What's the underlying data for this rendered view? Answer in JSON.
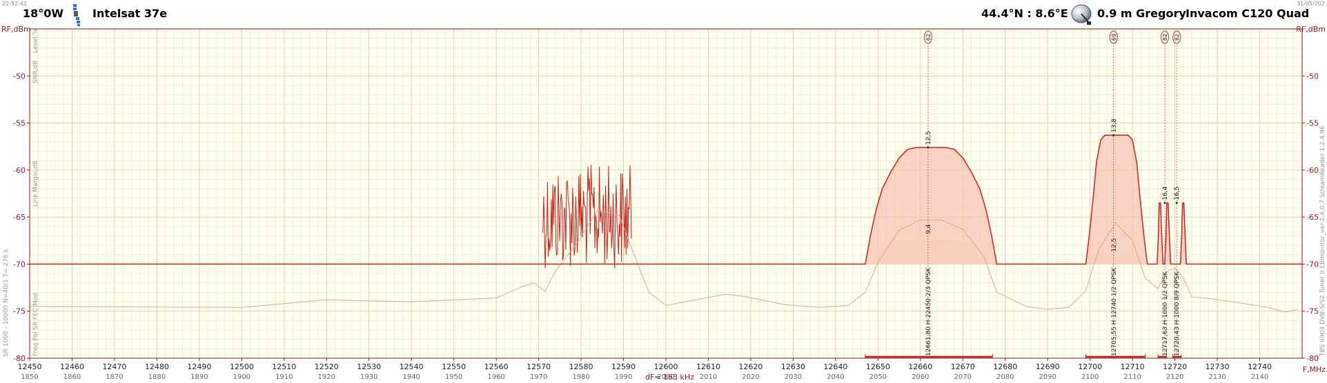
{
  "header": {
    "time": "22:52:42",
    "date": "31/05/202",
    "orbital_position": "18°0W",
    "satellite_name": "Intelsat 37e",
    "location": "44.4°N : 8.6°E",
    "dish_info": "0.9 m Gregory",
    "lnb_info": "Invacom C120 Quad",
    "satellite_icon": "satellite-icon",
    "dish_icon": "dish-icon"
  },
  "colors": {
    "background": "#fffff0",
    "grid": "#e2dcc0",
    "axis": "#8b1a1a",
    "trace": "#c8201a",
    "fill": "#f7c4b4",
    "avg": "#e8a090"
  },
  "side_labels": {
    "left_top": [
      "Level,%",
      "SNR,dB",
      "Link Margin,dB"
    ],
    "left_bottom": "Freq  Pol  SR  FEC  Mod",
    "left_params": "SR 1000 - 10000  N=40/1  T= 276 s",
    "right": "TBS 6903 DVB-S/S2 Tuner 0   EBmonitor_ver.2.4.0.7   StreamReader 1.2.4.96"
  },
  "chart_data": {
    "type": "line",
    "ylabel_left": "RF,dBm",
    "ylabel_right": "RF,dBm",
    "xlabel": "F,MHz",
    "xlim": [
      12450,
      12750
    ],
    "ylim": [
      -80,
      -45
    ],
    "yticks": [
      -50,
      -55,
      -60,
      -65,
      -70,
      -75,
      -80
    ],
    "xticks": [
      12450,
      12460,
      12470,
      12480,
      12490,
      12500,
      12510,
      12520,
      12530,
      12540,
      12550,
      12560,
      12570,
      12580,
      12590,
      12600,
      12610,
      12620,
      12630,
      12640,
      12650,
      12660,
      12670,
      12680,
      12690,
      12700,
      12710,
      12720,
      12730,
      12740
    ],
    "xticks_if": [
      1850,
      1860,
      1870,
      1880,
      1890,
      1900,
      1910,
      1920,
      1930,
      1940,
      1950,
      1960,
      1970,
      1980,
      1990,
      2000,
      2010,
      2020,
      2030,
      2040,
      2050,
      2060,
      2070,
      2080,
      2090,
      2100,
      2110,
      2120,
      2130,
      2140
    ],
    "df_label": "dF= 163 kHz",
    "grid": true,
    "noise_floor": -70,
    "spectrum": [
      [
        12450,
        -70
      ],
      [
        12570.5,
        -70
      ],
      [
        12591,
        -70
      ],
      [
        12647,
        -70
      ],
      [
        12648.2,
        -67
      ],
      [
        12649.5,
        -64.3
      ],
      [
        12651,
        -62
      ],
      [
        12653,
        -60.2
      ],
      [
        12655,
        -58.7
      ],
      [
        12657,
        -57.8
      ],
      [
        12659,
        -57.6
      ],
      [
        12666,
        -57.6
      ],
      [
        12668,
        -57.8
      ],
      [
        12670,
        -58.7
      ],
      [
        12672,
        -60.2
      ],
      [
        12674,
        -62
      ],
      [
        12675.5,
        -64.3
      ],
      [
        12676.8,
        -67
      ],
      [
        12678,
        -70
      ],
      [
        12699,
        -70
      ],
      [
        12699.8,
        -67
      ],
      [
        12700.6,
        -63.5
      ],
      [
        12701.5,
        -59.2
      ],
      [
        12702.5,
        -56.8
      ],
      [
        12703.5,
        -56.3
      ],
      [
        12709,
        -56.3
      ],
      [
        12710,
        -56.8
      ],
      [
        12711,
        -59.2
      ],
      [
        12711.9,
        -63.5
      ],
      [
        12712.7,
        -67
      ],
      [
        12713.5,
        -70
      ],
      [
        12715.8,
        -70
      ],
      [
        12716.1,
        -67
      ],
      [
        12716.3,
        -63.5
      ],
      [
        12716.6,
        -63.5
      ],
      [
        12716.9,
        -67
      ],
      [
        12717.2,
        -70
      ],
      [
        12717.6,
        -70
      ],
      [
        12717.9,
        -67
      ],
      [
        12718.1,
        -63.5
      ],
      [
        12718.4,
        -63.5
      ],
      [
        12718.7,
        -67
      ],
      [
        12719,
        -70
      ],
      [
        12721.3,
        -70
      ],
      [
        12721.6,
        -67
      ],
      [
        12721.8,
        -63.5
      ],
      [
        12722.1,
        -63.5
      ],
      [
        12722.4,
        -67
      ],
      [
        12722.7,
        -70
      ],
      [
        12750,
        -70
      ]
    ],
    "noise_region": {
      "x_start": 12571,
      "x_end": 12592,
      "peak": -59.4,
      "min": -70.5
    },
    "average": [
      [
        12450,
        -74.5
      ],
      [
        12500,
        -74.6
      ],
      [
        12520,
        -73.8
      ],
      [
        12540,
        -74
      ],
      [
        12560,
        -73.6
      ],
      [
        12566,
        -72.4
      ],
      [
        12569,
        -72
      ],
      [
        12571.5,
        -72.9
      ],
      [
        12574,
        -70.7
      ],
      [
        12579,
        -67.8
      ],
      [
        12584,
        -64.2
      ],
      [
        12589,
        -64.8
      ],
      [
        12592,
        -68.4
      ],
      [
        12596,
        -73
      ],
      [
        12600,
        -74.4
      ],
      [
        12614,
        -73.2
      ],
      [
        12618,
        -73.4
      ],
      [
        12628,
        -74.3
      ],
      [
        12636,
        -74.6
      ],
      [
        12643,
        -74.4
      ],
      [
        12647,
        -73
      ],
      [
        12650,
        -69.8
      ],
      [
        12655,
        -66.4
      ],
      [
        12660,
        -65.3
      ],
      [
        12665,
        -65.3
      ],
      [
        12670,
        -66.3
      ],
      [
        12675,
        -69.2
      ],
      [
        12678,
        -73
      ],
      [
        12685,
        -74.5
      ],
      [
        12690,
        -74.8
      ],
      [
        12695,
        -74.6
      ],
      [
        12699,
        -72.8
      ],
      [
        12702,
        -68.5
      ],
      [
        12706,
        -65.6
      ],
      [
        12710,
        -67.5
      ],
      [
        12713,
        -71.5
      ],
      [
        12716,
        -72.6
      ],
      [
        12718,
        -70.8
      ],
      [
        12720,
        -70.4
      ],
      [
        12722,
        -71.5
      ],
      [
        12724,
        -73.5
      ],
      [
        12727,
        -73.6
      ],
      [
        12735,
        -74.1
      ],
      [
        12742,
        -74.6
      ],
      [
        12746,
        -75.1
      ],
      [
        12749,
        -74.8
      ]
    ],
    "lower_fill": [
      [
        {
          "x": 12648,
          "y": -70
        },
        {
          "x": 12651,
          "y": -68.4
        },
        {
          "x": 12655,
          "y": -67.5
        },
        {
          "x": 12660,
          "y": -67.3
        },
        {
          "x": 12665,
          "y": -67.3
        },
        {
          "x": 12670,
          "y": -67.6
        },
        {
          "x": 12674,
          "y": -68.5
        },
        {
          "x": 12677,
          "y": -70
        }
      ],
      [
        {
          "x": 12700.5,
          "y": -70
        },
        {
          "x": 12701.5,
          "y": -69
        },
        {
          "x": 12703,
          "y": -68.9
        },
        {
          "x": 12710,
          "y": -68.9
        },
        {
          "x": 12711.5,
          "y": -69
        },
        {
          "x": 12712.5,
          "y": -70
        }
      ]
    ],
    "carriers": [
      {
        "freq": 12661.8,
        "top": -57.6,
        "badge": "62",
        "snr": "12,5",
        "margin": "9,4",
        "label": "12661,80  H  22450 2/3  QPSK",
        "band": [
          12647,
          12677
        ]
      },
      {
        "freq": 12705.55,
        "top": -56.3,
        "badge": "69",
        "snr": "13,8",
        "margin": "",
        "label": "12705,55  H  12740 1/2  QPSK",
        "extra": "12,5",
        "band": [
          12699,
          12713
        ]
      },
      {
        "freq": 12717.63,
        "top": -63.5,
        "badge": "82",
        "snr": "16,4",
        "margin": "",
        "label": "12717,63  H  1000 1/2  QPSK",
        "band": [
          12716,
          12718
        ]
      },
      {
        "freq": 12720.43,
        "top": -63.5,
        "badge": "82",
        "snr": "16,5",
        "margin": "",
        "label": "12720,43  H  1000 8/9  QPSK",
        "band": [
          12719.5,
          12721.5
        ]
      }
    ]
  }
}
